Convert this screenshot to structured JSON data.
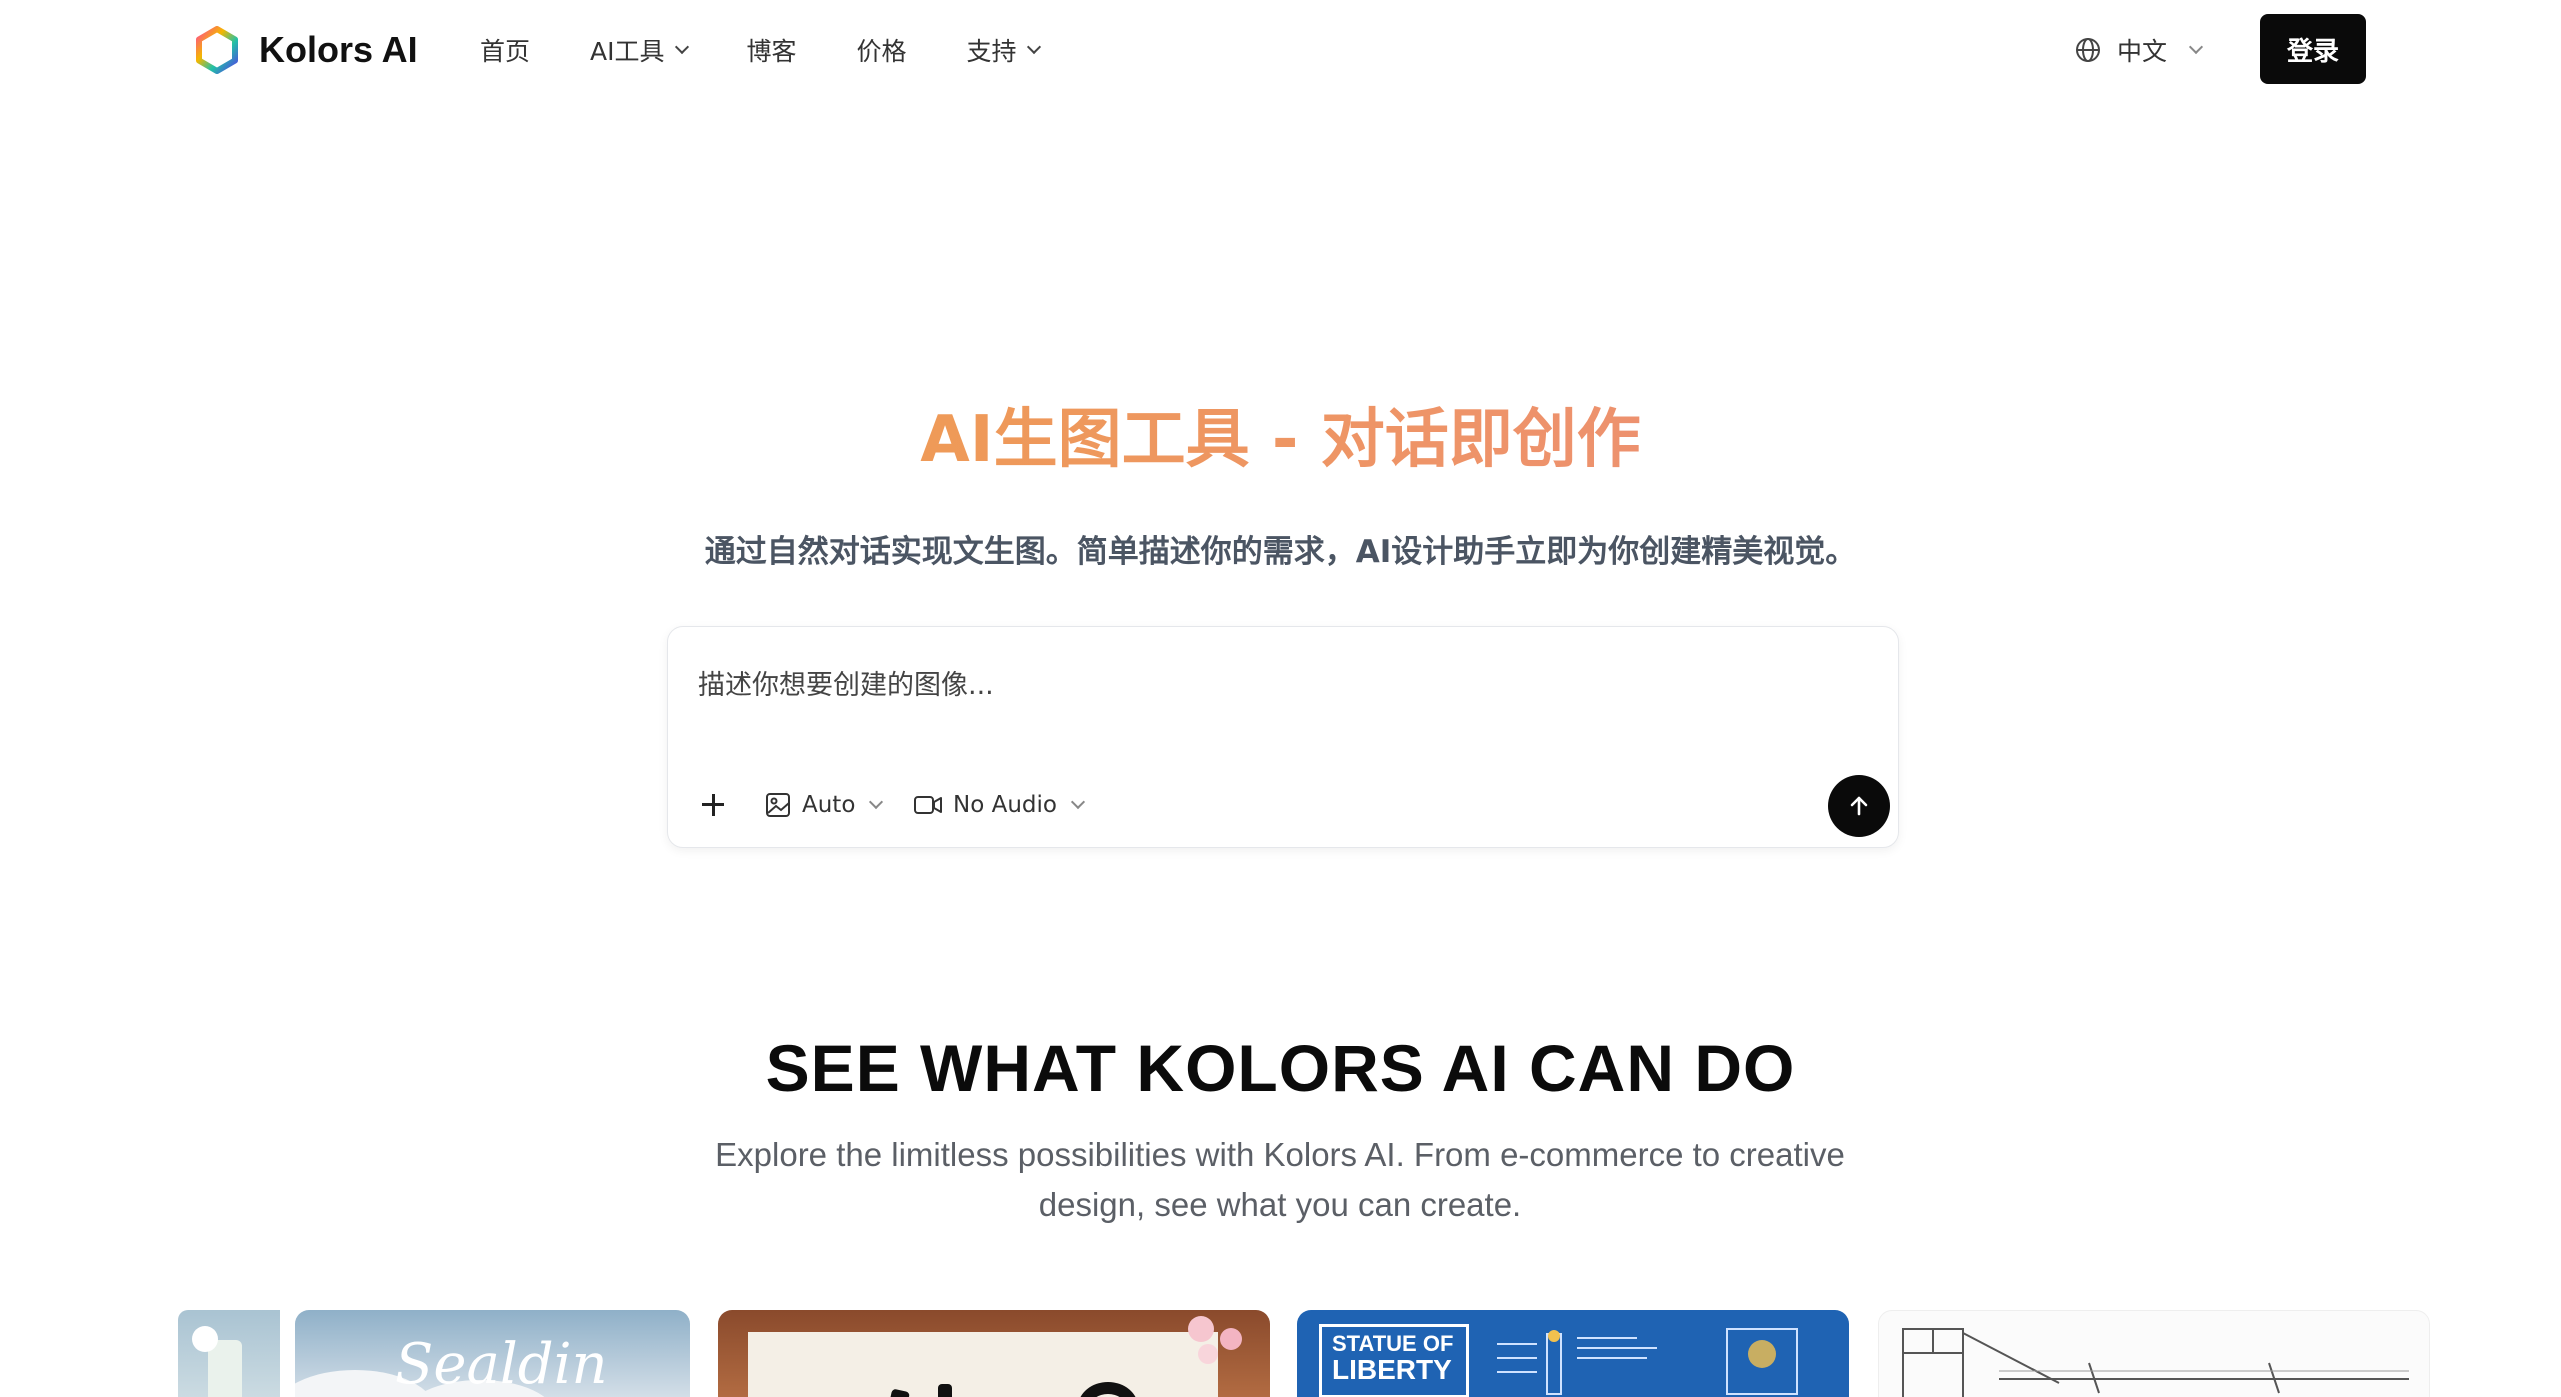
{
  "header": {
    "brand": "Kolors AI",
    "nav": [
      {
        "label": "首页",
        "dropdown": false
      },
      {
        "label": "AI工具",
        "dropdown": true
      },
      {
        "label": "博客",
        "dropdown": false
      },
      {
        "label": "价格",
        "dropdown": false
      },
      {
        "label": "支持",
        "dropdown": true
      }
    ],
    "language": "中文",
    "login_label": "登录"
  },
  "hero": {
    "title": "AI生图工具 - 对话即创作",
    "subtitle": "通过自然对话实现文生图。简单描述你的需求，AI设计助手立即为你创建精美视觉。",
    "prompt": {
      "placeholder": "描述你想要创建的图像...",
      "value": "",
      "ratio_label": "Auto",
      "audio_label": "No Audio"
    }
  },
  "showcase": {
    "title": "SEE WHAT KOLORS AI CAN DO",
    "subtitle": "Explore the limitless possibilities with Kolors AI. From e-commerce to creative design, see what you can create.",
    "card_texts": {
      "script_word": "Sealdin",
      "statue_line1": "STATUE OF",
      "statue_line2": "LIBERTY"
    }
  },
  "colors": {
    "title_gradient": [
      "#f0a53a",
      "#ee9467",
      "#e9868a"
    ],
    "button_bg": "#0a0a0a",
    "subtitle_text": "#4b5563"
  },
  "icons": [
    "hexagon-logo-icon",
    "chevron-down-icon",
    "globe-icon",
    "plus-icon",
    "image-icon",
    "video-icon",
    "arrow-up-icon"
  ]
}
